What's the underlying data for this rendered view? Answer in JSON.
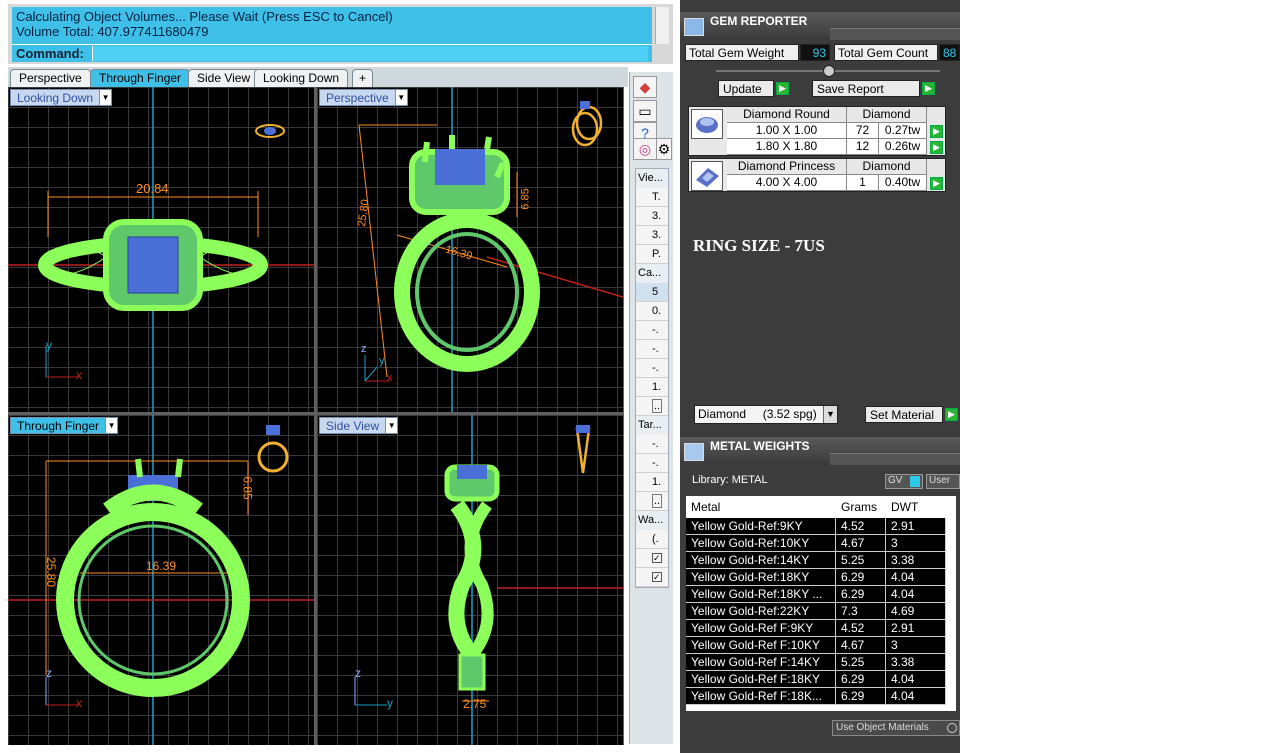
{
  "command": {
    "history": [
      "Calculating Object Volumes... Please Wait (Press ESC to Cancel)",
      "Volume Total: 407.977411680479"
    ],
    "prompt": "Command:"
  },
  "viewport_tabs": [
    {
      "label": "Perspective",
      "active": false
    },
    {
      "label": "Through Finger",
      "active": true
    },
    {
      "label": "Side View",
      "active": false
    },
    {
      "label": "Looking Down",
      "active": false
    },
    {
      "label": "+",
      "active": false
    }
  ],
  "viewports": {
    "top_left": {
      "title": "Looking Down",
      "dim_width": "20.84",
      "axis_x": "x",
      "axis_y": "y"
    },
    "top_right": {
      "title": "Perspective",
      "dim_a": "25.80",
      "dim_b": "16.39",
      "dim_c": "6.85",
      "axis_x": "x",
      "axis_y": "y",
      "axis_z": "z"
    },
    "bottom_left": {
      "title": "Through Finger",
      "dim_height": "25.80",
      "dim_inner": "16.39",
      "dim_head": "6.85",
      "axis_x": "x",
      "axis_z": "z"
    },
    "bottom_right": {
      "title": "Side View",
      "dim_shank": "2.75",
      "axis_y": "y",
      "axis_z": "z"
    }
  },
  "side_panel": {
    "section_view": "Vie...",
    "view_rows": [
      "T.",
      "3.",
      "3.",
      "P."
    ],
    "section_camera": "Ca...",
    "camera_rows": [
      "5",
      "0.",
      "-.",
      "-.",
      "-.",
      "1."
    ],
    "section_target": "Tar...",
    "target_rows": [
      "-.",
      "-.",
      "1."
    ],
    "section_wallpaper": "Wa...",
    "wallpaper_rows": [
      "(.",
      "",
      ""
    ]
  },
  "gem_reporter": {
    "title": "GEM REPORTER",
    "total_weight_label": "Total Gem Weight",
    "total_weight_value": "93",
    "total_count_label": "Total Gem Count",
    "total_count_value": "88",
    "update_label": "Update",
    "save_label": "Save Report",
    "gems": [
      {
        "shape": "Diamond Round",
        "material": "Diamond",
        "rows": [
          {
            "size": "1.00 X 1.00",
            "count": "72",
            "tw": "0.27tw"
          },
          {
            "size": "1.80 X 1.80",
            "count": "12",
            "tw": "0.26tw"
          }
        ]
      },
      {
        "shape": "Diamond Princess",
        "material": "Diamond",
        "rows": [
          {
            "size": "4.00 X 4.00",
            "count": "1",
            "tw": "0.40tw"
          }
        ]
      }
    ],
    "ring_size": "RING SIZE - 7US",
    "material_select": "Diamond     (3.52 spg)",
    "set_material_label": "Set Material"
  },
  "metal_weights": {
    "title": "METAL WEIGHTS",
    "library_label": "Library: METAL",
    "gv_label": "GV",
    "user_label": "User",
    "headers": [
      "Metal",
      "Grams",
      "DWT"
    ],
    "rows": [
      [
        "Yellow Gold-Ref:9KY",
        "4.52",
        "2.91"
      ],
      [
        "Yellow Gold-Ref:10KY",
        "4.67",
        "3"
      ],
      [
        "Yellow Gold-Ref:14KY",
        "5.25",
        "3.38"
      ],
      [
        "Yellow Gold-Ref:18KY",
        "6.29",
        "4.04"
      ],
      [
        "Yellow Gold-Ref:18KY ...",
        "6.29",
        "4.04"
      ],
      [
        "Yellow Gold-Ref:22KY",
        "7.3",
        "4.69"
      ],
      [
        "Yellow Gold-Ref F:9KY",
        "4.52",
        "2.91"
      ],
      [
        "Yellow Gold-Ref F:10KY",
        "4.67",
        "3"
      ],
      [
        "Yellow Gold-Ref F:14KY",
        "5.25",
        "3.38"
      ],
      [
        "Yellow Gold-Ref F:18KY",
        "6.29",
        "4.04"
      ],
      [
        "Yellow Gold-Ref F:18K...",
        "6.29",
        "4.04"
      ]
    ],
    "use_object_materials": "Use Object Materials"
  },
  "colors": {
    "accent": "#3ec0e8",
    "wire": "#8cff5a",
    "gem": "#4a70d8",
    "dimension": "#ff8c20"
  }
}
